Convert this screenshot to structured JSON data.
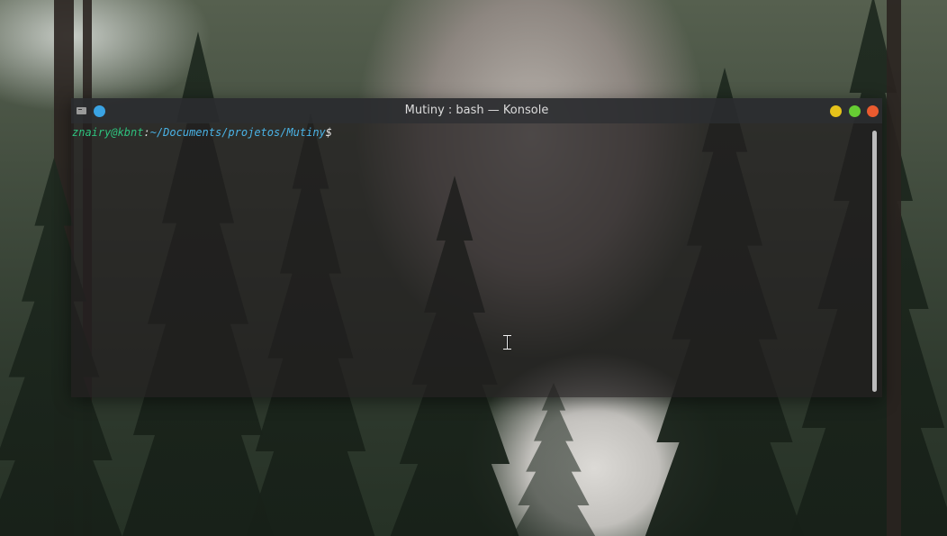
{
  "window": {
    "title": "Mutiny : bash — Konsole",
    "app_icon": "terminal-icon",
    "pin_icon": "pin-icon",
    "controls": {
      "minimize_icon": "minimize-icon",
      "maximize_icon": "maximize-icon",
      "close_icon": "close-icon"
    },
    "colors": {
      "pin": "#3aa3e3",
      "minimize": "#e5c21a",
      "maximize": "#66cc33",
      "close": "#ea5b2f"
    }
  },
  "terminal": {
    "prompt": {
      "user_host": "znairy@kbnt",
      "separator": ":",
      "path": "~/Documents/projetos/Mutiny",
      "symbol": "$"
    },
    "prompt_colors": {
      "user_host": "#2ec27e",
      "path": "#4ab3e6"
    },
    "mouse_cursor": "text-cursor-icon"
  }
}
